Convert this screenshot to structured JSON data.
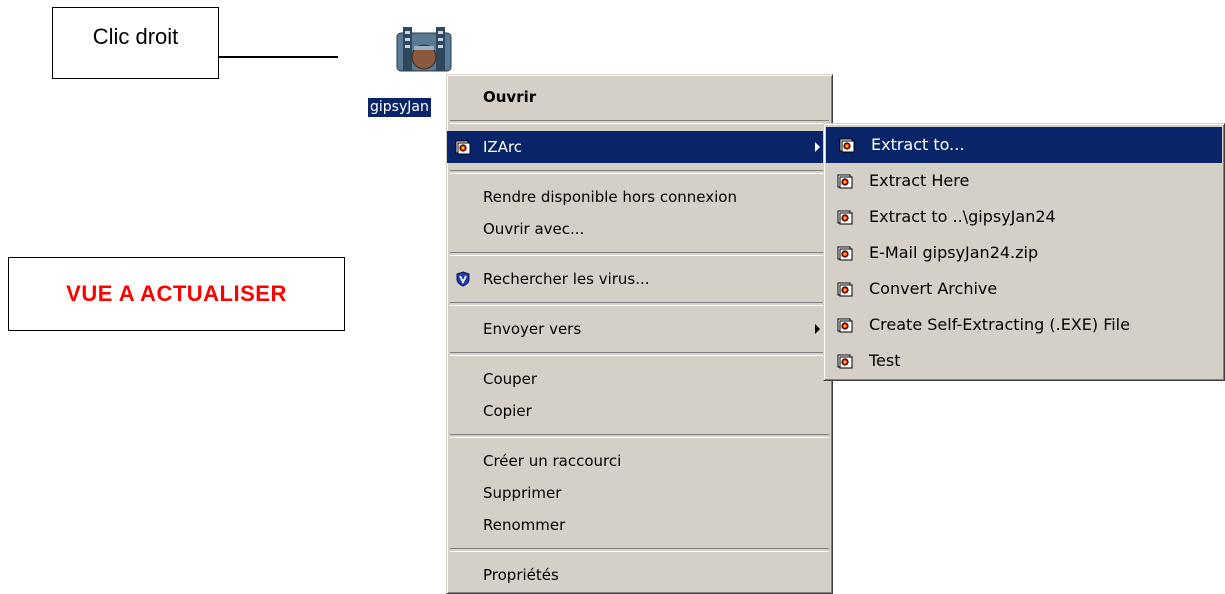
{
  "callouts": {
    "right_click": "Clic droit",
    "refresh_view": "VUE A ACTUALISER"
  },
  "desktop_icon": {
    "icon": "izarc-archive-icon",
    "label": "gipsyJan"
  },
  "context_menu": {
    "open": "Ouvrir",
    "izarc": "IZArc",
    "offline": "Rendre disponible hors connexion",
    "open_with": "Ouvrir avec...",
    "scan_virus": "Rechercher les virus...",
    "send_to": "Envoyer vers",
    "cut": "Couper",
    "copy": "Copier",
    "create_shortcut": "Créer un raccourci",
    "delete": "Supprimer",
    "rename": "Renommer",
    "properties": "Propriétés"
  },
  "submenu": {
    "extract_to": "Extract to...",
    "extract_here": "Extract Here",
    "extract_to_folder": "Extract to ..\\gipsyJan24",
    "email": "E-Mail gipsyJan24.zip",
    "convert": "Convert Archive",
    "self_extract": "Create Self-Extracting (.EXE) File",
    "test": "Test"
  },
  "colors": {
    "highlight": "#0a246a",
    "menu_bg": "#d4d0c8",
    "alert_text": "#ff0000"
  }
}
